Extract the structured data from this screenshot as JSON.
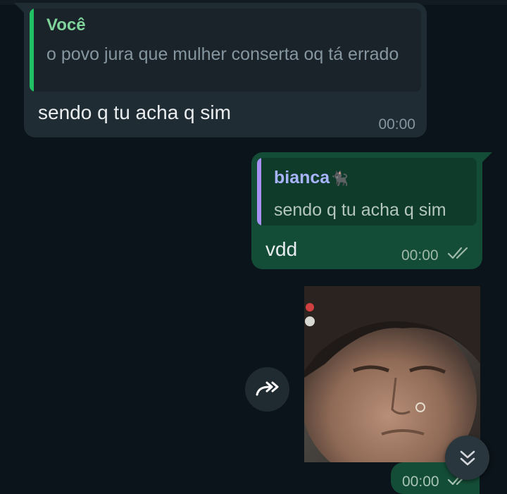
{
  "messages": {
    "incoming": {
      "quote_author": "Você",
      "quote_text": "o povo jura que mulher conserta oq tá errado",
      "text": "sendo q tu acha q sim",
      "time": "00:00"
    },
    "outgoing": {
      "quote_author": "bianca",
      "quote_author_emoji": "🐈‍⬛",
      "quote_text": "sendo q tu acha q sim",
      "text": "vdd",
      "time": "00:00",
      "status_icon": "double-check-icon"
    },
    "image": {
      "time": "00:00",
      "status_icon": "double-check-icon"
    }
  },
  "controls": {
    "forward_icon": "forward-icon",
    "scroll_icon": "chevron-double-down-icon"
  },
  "colors": {
    "background": "#0b141a",
    "incoming_bubble": "#202c33",
    "outgoing_bubble": "#144d37",
    "quote_bar_in": "#21c063",
    "quote_bar_out": "#a791f5"
  }
}
